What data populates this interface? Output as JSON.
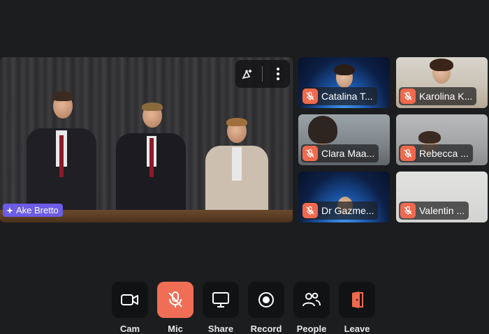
{
  "main_stage": {
    "speaker_name": "Ake Bretto"
  },
  "participants": [
    {
      "name": "Catalina T...",
      "muted": true
    },
    {
      "name": "Karolina K...",
      "muted": true
    },
    {
      "name": "Clara Maa...",
      "muted": true
    },
    {
      "name": "Rebecca ...",
      "muted": true
    },
    {
      "name": "Dr Gazme...",
      "muted": true
    },
    {
      "name": "Valentin ...",
      "muted": true
    }
  ],
  "controls": {
    "cam": "Cam",
    "mic": "Mic",
    "share": "Share",
    "record": "Record",
    "people": "People",
    "leave": "Leave"
  },
  "colors": {
    "background": "#1c1d1f",
    "mute_badge": "#f0694e",
    "mic_active": "#ef6e55",
    "name_pill": "#6c5ce7",
    "leave_icon": "#f06a4e"
  },
  "icons": {
    "stage_tool_1": "antenna-sparkle-icon",
    "stage_tool_2": "more-vertical-icon"
  }
}
